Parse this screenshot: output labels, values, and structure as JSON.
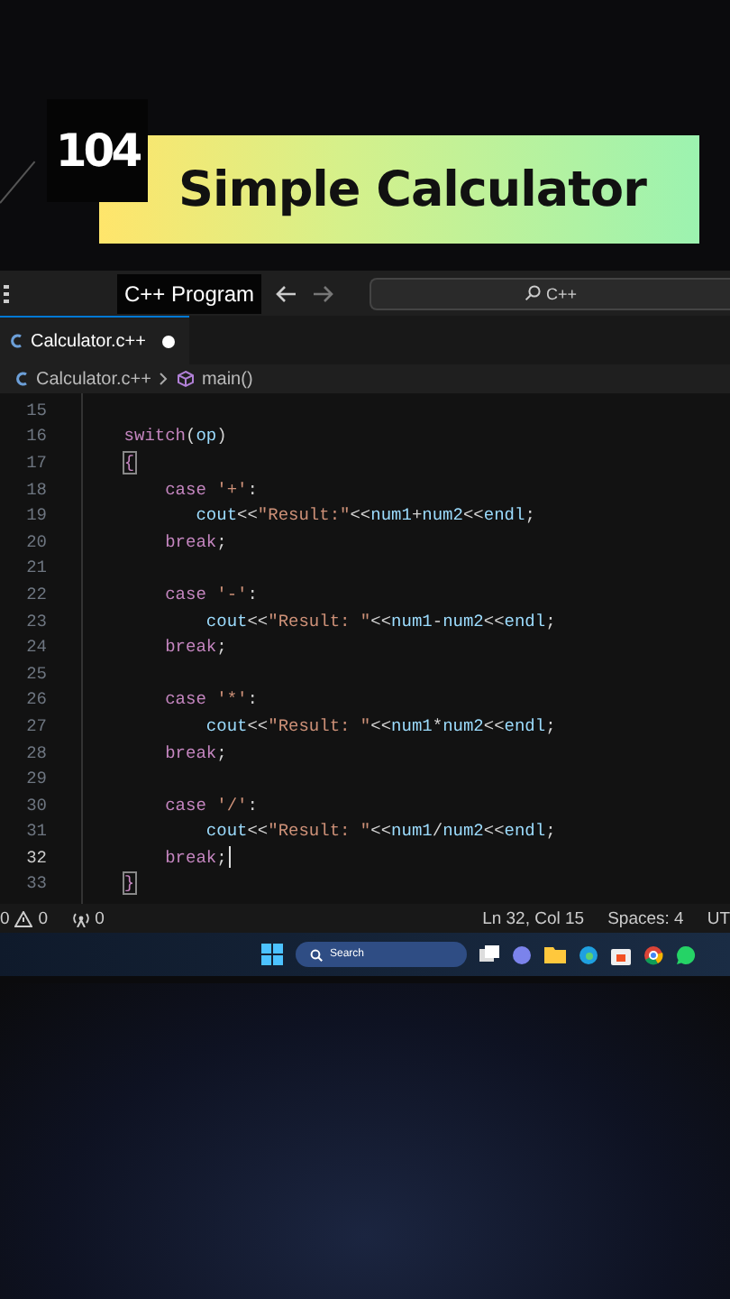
{
  "banner": {
    "number": "104",
    "title": "Simple Calculator"
  },
  "title_bar": {
    "label": "C++ Program",
    "search": "C++"
  },
  "tabs": [
    {
      "label": "Calculator.c++",
      "modified": true,
      "selected": true
    }
  ],
  "breadcrumb": {
    "file": "Calculator.c++",
    "symbol": "main()"
  },
  "code": [
    {
      "n": "15",
      "current": false,
      "cursor": false
    },
    {
      "n": "16",
      "current": false,
      "cursor": false,
      "tokens": [
        {
          "kind": "keyword",
          "text": "    switch"
        },
        {
          "kind": "punct",
          "text": "("
        },
        {
          "kind": "var",
          "text": "op"
        },
        {
          "kind": "punct",
          "text": ")"
        }
      ]
    },
    {
      "n": "17",
      "current": false,
      "cursor": false,
      "tokens": [
        {
          "kind": "bracket",
          "text": "    {"
        }
      ]
    },
    {
      "n": "18",
      "current": false,
      "cursor": false,
      "tokens": [
        {
          "kind": "keyword",
          "text": "        case "
        },
        {
          "kind": "string",
          "text": "'+'"
        },
        {
          "kind": "punct",
          "text": ":"
        }
      ]
    },
    {
      "n": "19",
      "current": false,
      "cursor": false,
      "tokens": [
        {
          "kind": "var",
          "text": "           cout"
        },
        {
          "kind": "punct",
          "text": "<<"
        },
        {
          "kind": "string",
          "text": "\"Result:\""
        },
        {
          "kind": "punct",
          "text": "<<"
        },
        {
          "kind": "var",
          "text": "num1"
        },
        {
          "kind": "punct",
          "text": "+"
        },
        {
          "kind": "var",
          "text": "num2"
        },
        {
          "kind": "punct",
          "text": "<<"
        },
        {
          "kind": "var",
          "text": "endl"
        },
        {
          "kind": "punct",
          "text": ";"
        }
      ]
    },
    {
      "n": "20",
      "current": false,
      "cursor": false,
      "tokens": [
        {
          "kind": "keyword",
          "text": "        break"
        },
        {
          "kind": "punct",
          "text": ";"
        }
      ]
    },
    {
      "n": "21",
      "current": false,
      "cursor": false
    },
    {
      "n": "22",
      "current": false,
      "cursor": false,
      "tokens": [
        {
          "kind": "keyword",
          "text": "        case "
        },
        {
          "kind": "string",
          "text": "'-'"
        },
        {
          "kind": "punct",
          "text": ":"
        }
      ]
    },
    {
      "n": "23",
      "current": false,
      "cursor": false,
      "tokens": [
        {
          "kind": "var",
          "text": "            cout"
        },
        {
          "kind": "punct",
          "text": "<<"
        },
        {
          "kind": "string",
          "text": "\"Result: \""
        },
        {
          "kind": "punct",
          "text": "<<"
        },
        {
          "kind": "var",
          "text": "num1"
        },
        {
          "kind": "punct",
          "text": "-"
        },
        {
          "kind": "var",
          "text": "num2"
        },
        {
          "kind": "punct",
          "text": "<<"
        },
        {
          "kind": "var",
          "text": "endl"
        },
        {
          "kind": "punct",
          "text": ";"
        }
      ]
    },
    {
      "n": "24",
      "current": false,
      "cursor": false,
      "tokens": [
        {
          "kind": "keyword",
          "text": "        break"
        },
        {
          "kind": "punct",
          "text": ";"
        }
      ]
    },
    {
      "n": "25",
      "current": false,
      "cursor": false
    },
    {
      "n": "26",
      "current": false,
      "cursor": false,
      "tokens": [
        {
          "kind": "keyword",
          "text": "        case "
        },
        {
          "kind": "string",
          "text": "'*'"
        },
        {
          "kind": "punct",
          "text": ":"
        }
      ]
    },
    {
      "n": "27",
      "current": false,
      "cursor": false,
      "tokens": [
        {
          "kind": "var",
          "text": "            cout"
        },
        {
          "kind": "punct",
          "text": "<<"
        },
        {
          "kind": "string",
          "text": "\"Result: \""
        },
        {
          "kind": "punct",
          "text": "<<"
        },
        {
          "kind": "var",
          "text": "num1"
        },
        {
          "kind": "punct",
          "text": "*"
        },
        {
          "kind": "var",
          "text": "num2"
        },
        {
          "kind": "punct",
          "text": "<<"
        },
        {
          "kind": "var",
          "text": "endl"
        },
        {
          "kind": "punct",
          "text": ";"
        }
      ]
    },
    {
      "n": "28",
      "current": false,
      "cursor": false,
      "tokens": [
        {
          "kind": "keyword",
          "text": "        break"
        },
        {
          "kind": "punct",
          "text": ";"
        }
      ]
    },
    {
      "n": "29",
      "current": false,
      "cursor": false
    },
    {
      "n": "30",
      "current": false,
      "cursor": false,
      "tokens": [
        {
          "kind": "keyword",
          "text": "        case "
        },
        {
          "kind": "string",
          "text": "'/'"
        },
        {
          "kind": "punct",
          "text": ":"
        }
      ]
    },
    {
      "n": "31",
      "current": false,
      "cursor": false,
      "tokens": [
        {
          "kind": "var",
          "text": "            cout"
        },
        {
          "kind": "punct",
          "text": "<<"
        },
        {
          "kind": "string",
          "text": "\"Result: \""
        },
        {
          "kind": "punct",
          "text": "<<"
        },
        {
          "kind": "var",
          "text": "num1"
        },
        {
          "kind": "punct",
          "text": "/"
        },
        {
          "kind": "var",
          "text": "num2"
        },
        {
          "kind": "punct",
          "text": "<<"
        },
        {
          "kind": "var",
          "text": "endl"
        },
        {
          "kind": "punct",
          "text": ";"
        }
      ]
    },
    {
      "n": "32",
      "current": true,
      "cursor": true,
      "tokens": [
        {
          "kind": "keyword",
          "text": "        break"
        },
        {
          "kind": "punct",
          "text": ";"
        }
      ]
    },
    {
      "n": "33",
      "current": false,
      "cursor": false,
      "tokens": [
        {
          "kind": "bracket",
          "text": "    }"
        }
      ]
    }
  ],
  "status_bar": {
    "errors": "0",
    "warnings": "0",
    "ports": "0",
    "position": "Ln 32, Col 15",
    "spaces": "Spaces: 4",
    "encoding": "UT"
  },
  "taskbar": {
    "search": "Search"
  }
}
